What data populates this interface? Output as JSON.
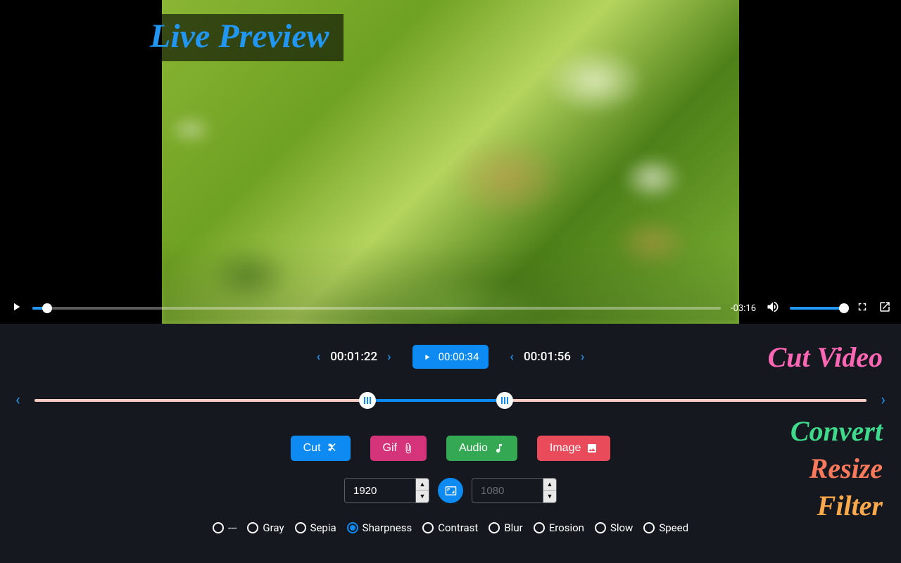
{
  "overlay": {
    "title": "Live Preview"
  },
  "player": {
    "remaining": "-03:16",
    "progress_pct": 2,
    "volume_pct": 100
  },
  "times": {
    "in": "00:01:22",
    "play": "00:00:34",
    "out": "00:01:56"
  },
  "range": {
    "start_pct": 40,
    "end_pct": 56.5
  },
  "actions": {
    "cut": "Cut",
    "gif": "Gif",
    "audio": "Audio",
    "image": "Image"
  },
  "size": {
    "width": "1920",
    "height_placeholder": "1080"
  },
  "filters": {
    "options": [
      "---",
      "Gray",
      "Sepia",
      "Sharpness",
      "Contrast",
      "Blur",
      "Erosion",
      "Slow",
      "Speed"
    ],
    "selected": "Sharpness"
  },
  "side": {
    "cut": "Cut Video",
    "convert": "Convert",
    "resize": "Resize",
    "filter": "Filter"
  }
}
